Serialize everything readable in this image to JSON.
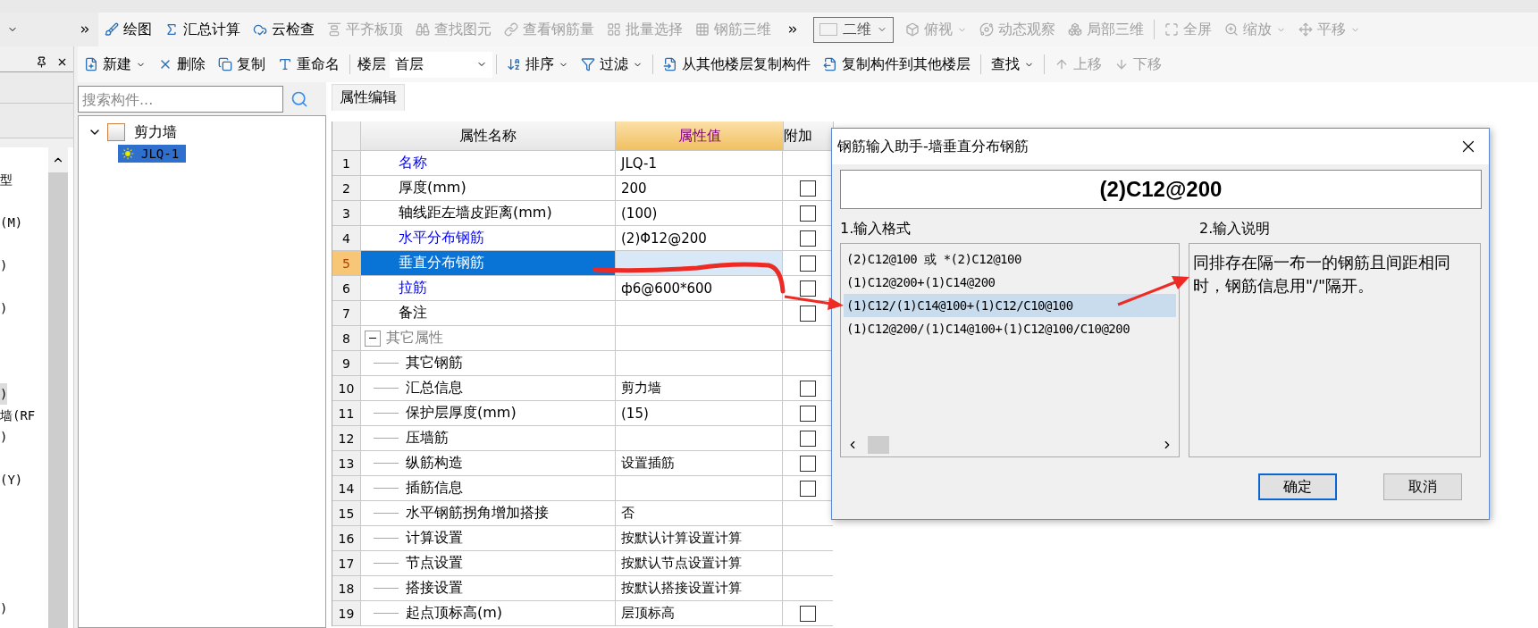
{
  "toolbar_main": [
    {
      "label": "绘图",
      "kind": "button",
      "disabled": false
    },
    {
      "label": "汇总计算",
      "kind": "button",
      "disabled": false
    },
    {
      "label": "云检查",
      "kind": "button",
      "disabled": false
    },
    {
      "label": "平齐板顶",
      "kind": "button",
      "disabled": true
    },
    {
      "label": "查找图元",
      "kind": "button",
      "disabled": true
    },
    {
      "label": "查看钢筋量",
      "kind": "button",
      "disabled": true
    },
    {
      "label": "批量选择",
      "kind": "button",
      "disabled": true
    },
    {
      "label": "钢筋三维",
      "kind": "button",
      "disabled": true
    }
  ],
  "toolbar_view": [
    {
      "label": "二维",
      "kind": "select",
      "disabled": false
    },
    {
      "label": "俯视",
      "kind": "dropdown",
      "disabled": true
    },
    {
      "label": "动态观察",
      "kind": "button",
      "disabled": true
    },
    {
      "label": "局部三维",
      "kind": "button",
      "disabled": true
    },
    {
      "kind": "separator"
    },
    {
      "label": "全屏",
      "kind": "button",
      "disabled": true
    },
    {
      "label": "缩放",
      "kind": "dropdown",
      "disabled": true
    },
    {
      "label": "平移",
      "kind": "dropdown",
      "disabled": true
    }
  ],
  "toolbar_edit": [
    {
      "label": "新建",
      "kind": "dropdown",
      "disabled": false
    },
    {
      "label": "删除",
      "kind": "button",
      "disabled": false
    },
    {
      "label": "复制",
      "kind": "button",
      "disabled": false
    },
    {
      "label": "重命名",
      "kind": "button",
      "disabled": false
    },
    {
      "kind": "separator"
    },
    {
      "label": "楼层",
      "kind": "label"
    },
    {
      "label": "首层",
      "kind": "select"
    },
    {
      "kind": "separator"
    },
    {
      "label": "排序",
      "kind": "dropdown",
      "disabled": false
    },
    {
      "label": "过滤",
      "kind": "dropdown",
      "disabled": false
    },
    {
      "kind": "separator"
    },
    {
      "label": "从其他楼层复制构件",
      "kind": "button",
      "disabled": false
    },
    {
      "label": "复制构件到其他楼层",
      "kind": "button",
      "disabled": false
    },
    {
      "kind": "separator"
    },
    {
      "label": "查找",
      "kind": "dropdown",
      "disabled": false
    },
    {
      "kind": "separator"
    },
    {
      "label": "上移",
      "kind": "button",
      "disabled": true
    },
    {
      "label": "下移",
      "kind": "button",
      "disabled": true
    }
  ],
  "side_list": [
    {
      "label": "型",
      "selected": false
    },
    {
      "label": "(M)",
      "selected": false
    },
    {
      "label": ")",
      "selected": false
    },
    {
      "label": ")",
      "selected": false
    },
    {
      "label": ")",
      "selected": true
    },
    {
      "label": "墙(RF",
      "selected": false
    },
    {
      "label": ")",
      "selected": false
    },
    {
      "label": "(Y)",
      "selected": false
    },
    {
      "label": ")",
      "selected": false
    }
  ],
  "component_search": {
    "placeholder": "搜索构件..."
  },
  "component_tree": [
    {
      "label": "剪力墙",
      "expanded": true,
      "children": [
        {
          "label": "JLQ-1",
          "selected": true
        }
      ]
    }
  ],
  "tab": {
    "label": "属性编辑",
    "selected": true
  },
  "table": {
    "columns": [
      {
        "label": "属性名称",
        "selected": false
      },
      {
        "label": "属性值",
        "selected": true
      },
      {
        "label": "附加",
        "selected": false
      }
    ],
    "rows": [
      {
        "index": "1",
        "name": "名称",
        "value": "JLQ-1",
        "color": "#0000ff",
        "selected": false
      },
      {
        "index": "2",
        "name": "厚度(mm)",
        "value": "200",
        "color": "#000000",
        "selected": false,
        "addon": false
      },
      {
        "index": "3",
        "name": "轴线距左墙皮距离(mm)",
        "value": "(100)",
        "color": "#000000",
        "selected": false,
        "addon": false
      },
      {
        "index": "4",
        "name": "水平分布钢筋",
        "value": "(2)Φ12@200",
        "color": "#0000ff",
        "selected": false,
        "addon": false
      },
      {
        "index": "5",
        "name": "垂直分布钢筋",
        "selected": true,
        "addon": false
      },
      {
        "index": "6",
        "name": "拉筋",
        "value": "ф6@600*600",
        "color": "#0000ff",
        "selected": false,
        "addon": false
      },
      {
        "index": "7",
        "name": "备注",
        "color": "#000000",
        "selected": false,
        "addon": false
      },
      {
        "index": "8",
        "name": "其它属性",
        "color": "#808080",
        "selected": false,
        "expanded": true,
        "children": [
          {
            "index": "9",
            "name": "其它钢筋",
            "selected": false
          },
          {
            "index": "10",
            "name": "汇总信息",
            "value": "剪力墙",
            "selected": false,
            "addon": false
          },
          {
            "index": "11",
            "name": "保护层厚度(mm)",
            "value": "(15)",
            "selected": false,
            "addon": false
          },
          {
            "index": "12",
            "name": "压墙筋",
            "selected": false,
            "addon": false
          },
          {
            "index": "13",
            "name": "纵筋构造",
            "value": "设置插筋",
            "selected": false,
            "addon": false
          },
          {
            "index": "14",
            "name": "插筋信息",
            "selected": false,
            "addon": false
          },
          {
            "index": "15",
            "name": "水平钢筋拐角增加搭接",
            "value": "否",
            "selected": false
          },
          {
            "index": "16",
            "name": "计算设置",
            "value": "按默认计算设置计算",
            "selected": false
          },
          {
            "index": "17",
            "name": "节点设置",
            "value": "按默认节点设置计算",
            "selected": false
          },
          {
            "index": "18",
            "name": "搭接设置",
            "value": "按默认搭接设置计算",
            "selected": false
          },
          {
            "index": "19",
            "name": "起点顶标高(m)",
            "value": "层顶标高",
            "selected": false,
            "addon": false
          }
        ]
      }
    ]
  },
  "dialog": {
    "title": "钢筋输入助手-墙垂直分布钢筋",
    "value": "(2)C12@200",
    "format_label": "1.输入格式",
    "formats": [
      {
        "label": "(2)C12@100 或 *(2)C12@100",
        "selected": false
      },
      {
        "label": "(1)C12@200+(1)C14@200",
        "selected": false
      },
      {
        "label": "(1)C12/(1)C14@100+(1)C12/C10@100",
        "selected": true
      },
      {
        "label": "(1)C12@200/(1)C14@100+(1)C12@100/C10@200",
        "selected": false
      }
    ],
    "note_label": "2.输入说明",
    "note": "同排存在隔一布一的钢筋且间距相同时，钢筋信息用\"/\"隔开。",
    "buttons": [
      {
        "label": "确定",
        "default": true
      },
      {
        "label": "取消",
        "default": false
      }
    ]
  }
}
